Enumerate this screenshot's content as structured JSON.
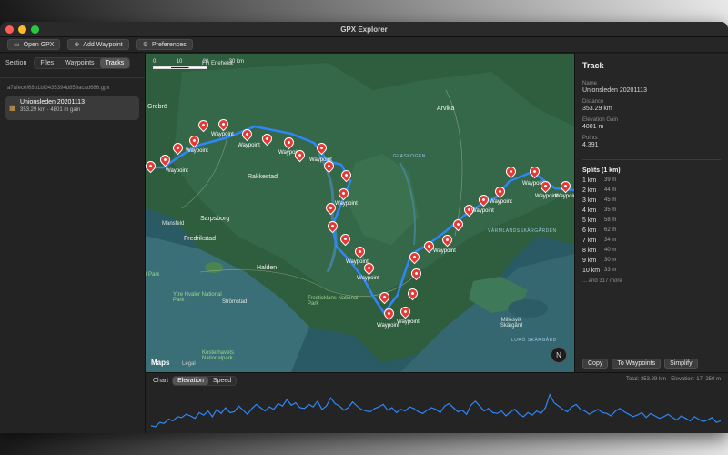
{
  "window": {
    "title": "GPX Explorer"
  },
  "toolbar": {
    "open_label": "Open GPX",
    "add_waypoint_label": "Add Waypoint",
    "preferences_label": "Preferences"
  },
  "sidebar": {
    "section_label": "Section",
    "tabs": [
      {
        "label": "Files"
      },
      {
        "label": "Waypoints"
      },
      {
        "label": "Tracks"
      }
    ],
    "active_tab": "Tracks",
    "file_hash": "a7afecef68b1bf0435394d859acad686.gpx",
    "track": {
      "name": "Unionsleden 20201113",
      "subtitle": "353.29 km · 4801 m gain"
    }
  },
  "map": {
    "scale": {
      "n0": "0",
      "n1": "10",
      "n2": "20",
      "n3": "30 km"
    },
    "attribution": "Maps",
    "legal": "Legal",
    "compass": "N",
    "places": {
      "gr_ebroe": "Grebrö",
      "arvika": "Arvika",
      "rakkestad": "Rakkestad",
      "sarpsborg": "Sarpsborg",
      "fredrikstad": "Fredrikstad",
      "halden": "Halden",
      "mansfeld": "Mansfeld",
      "stromstad": "Strömstad",
      "ytre": "Ytre Hvaler National Park",
      "tresticklans": "Tresticklans National Park",
      "kosterhavets": "Kosterhavets Nationalpark",
      "glaskogen": "GLASKOGEN",
      "varmland": "VÄRMLANDSSKÄRGÅRDEN",
      "lurosk": "LURÖ SKÄRGÅRD",
      "millesvik": "Millesvik Skärgård",
      "park_left": "l Park",
      "bottom_right_ids": "4 rb",
      "scale_towns": "Fin Eneheka",
      "route_numbers": "E18"
    },
    "waypoint_label": "Waypoint"
  },
  "inspector": {
    "title": "Track",
    "name_label": "Name",
    "name_value": "Unionsleden 20201113",
    "distance_label": "Distance",
    "distance_value": "353.29 km",
    "gain_label": "Elevation Gain",
    "gain_value": "4801 m",
    "points_label": "Points",
    "points_value": "4.391",
    "splits_title": "Splits (1 km)",
    "splits": [
      {
        "km": "1 km",
        "m": "39 m"
      },
      {
        "km": "2 km",
        "m": "44 m"
      },
      {
        "km": "3 km",
        "m": "45 m"
      },
      {
        "km": "4 km",
        "m": "35 m"
      },
      {
        "km": "5 km",
        "m": "58 m"
      },
      {
        "km": "6 km",
        "m": "62 m"
      },
      {
        "km": "7 km",
        "m": "34 m"
      },
      {
        "km": "8 km",
        "m": "40 m"
      },
      {
        "km": "9 km",
        "m": "30 m"
      },
      {
        "km": "10 km",
        "m": "33 m"
      }
    ],
    "more": "... and 317 more",
    "buttons": {
      "copy": "Copy",
      "to_waypoints": "To Waypoints",
      "simplify": "Simplify"
    }
  },
  "chart": {
    "label": "Chart",
    "tabs": [
      {
        "label": "Elevation"
      },
      {
        "label": "Speed"
      }
    ],
    "active_tab": "Elevation",
    "summary": "Total: 353.29 km · Elevation: 17–250 m"
  },
  "colors": {
    "track_line": "#2f86f6",
    "pin": "#e53935",
    "chart_line": "#2f86f6"
  },
  "chart_data": {
    "type": "line",
    "title": "",
    "xlabel": "",
    "ylabel": "",
    "ylim": [
      17,
      250
    ],
    "series": [
      {
        "values": [
          40,
          35,
          60,
          55,
          80,
          70,
          95,
          90,
          110,
          100,
          85,
          120,
          105,
          130,
          95,
          140,
          115,
          150,
          120,
          125,
          160,
          135,
          110,
          145,
          170,
          150,
          130,
          155,
          140,
          175,
          160,
          200,
          165,
          180,
          150,
          145,
          170,
          155,
          190,
          140,
          160,
          210,
          175,
          160,
          135,
          150,
          185,
          160,
          140,
          130,
          125,
          145,
          155,
          170,
          135,
          150,
          120,
          140,
          130,
          155,
          145,
          125,
          115,
          135,
          150,
          140,
          120,
          160,
          175,
          150,
          125,
          135,
          110,
          165,
          190,
          160,
          130,
          145,
          120,
          115,
          130,
          100,
          125,
          140,
          110,
          95,
          120,
          105,
          130,
          115,
          150,
          230,
          180,
          160,
          140,
          125,
          155,
          170,
          140,
          130,
          110,
          125,
          140,
          120,
          115,
          100,
          130,
          145,
          125,
          110,
          95,
          105,
          120,
          90,
          115,
          100,
          85,
          95,
          110,
          90,
          75,
          100,
          85,
          70,
          95,
          80,
          65,
          75,
          90,
          60,
          70
        ]
      }
    ]
  }
}
